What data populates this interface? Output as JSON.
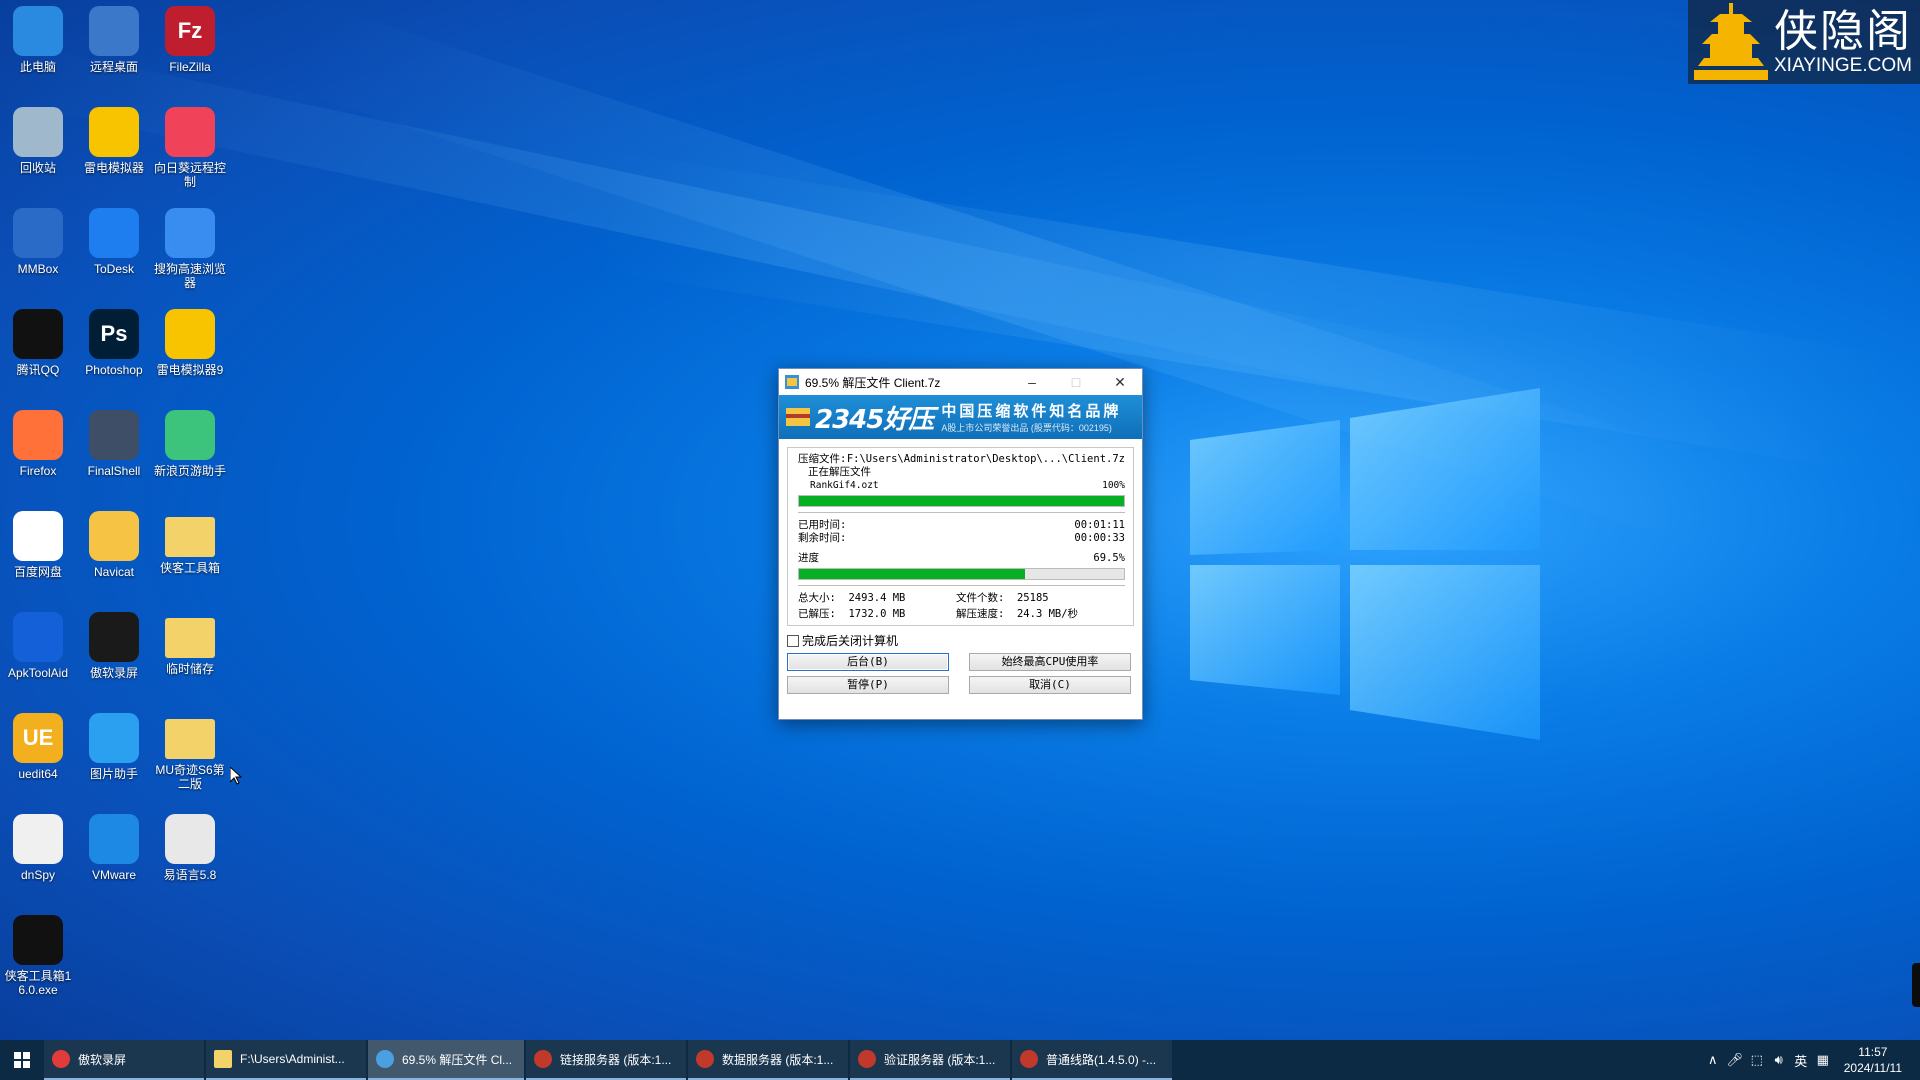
{
  "desktop_icons": [
    {
      "label": "此电脑",
      "icon": "computer-icon",
      "color": "#2a8ae0"
    },
    {
      "label": "远程桌面",
      "icon": "remote-desktop-icon",
      "color": "#3b78c9"
    },
    {
      "label": "FileZilla",
      "icon": "filezilla-icon",
      "color": "#bf1e2e",
      "glyph": "Fz"
    },
    {
      "label": "回收站",
      "icon": "recycle-bin-icon",
      "color": "#9fb8cc"
    },
    {
      "label": "雷电模拟器",
      "icon": "ldplayer-icon",
      "color": "#f8c400"
    },
    {
      "label": "向日葵远程控制",
      "icon": "sunlogin-icon",
      "color": "#f0435a"
    },
    {
      "label": "MMBox",
      "icon": "mmbox-icon",
      "color": "#2b6bc8"
    },
    {
      "label": "ToDesk",
      "icon": "todesk-icon",
      "color": "#1e7ef0"
    },
    {
      "label": "搜狗高速浏览器",
      "icon": "sogou-browser-icon",
      "color": "#3a8df0"
    },
    {
      "label": "腾讯QQ",
      "icon": "qq-icon",
      "color": "#111111"
    },
    {
      "label": "Photoshop",
      "icon": "photoshop-icon",
      "color": "#001e36",
      "glyph": "Ps"
    },
    {
      "label": "雷电模拟器9",
      "icon": "ldplayer9-icon",
      "color": "#f8c400"
    },
    {
      "label": "Firefox",
      "icon": "firefox-icon",
      "color": "#ff7139"
    },
    {
      "label": "FinalShell",
      "icon": "finalshell-icon",
      "color": "#3d4e66"
    },
    {
      "label": "新浪页游助手",
      "icon": "sina-game-icon",
      "color": "#3cc47c"
    },
    {
      "label": "百度网盘",
      "icon": "baidu-netdisk-icon",
      "color": "#ffffff"
    },
    {
      "label": "Navicat",
      "icon": "navicat-icon",
      "color": "#f6c345"
    },
    {
      "label": "侠客工具箱",
      "icon": "folder-icon",
      "color": "#f3d26a"
    },
    {
      "label": "ApkToolAid",
      "icon": "apktoolaid-icon",
      "color": "#1460d8"
    },
    {
      "label": "傲软录屏",
      "icon": "apowersoft-recorder-icon",
      "color": "#1a1a1a"
    },
    {
      "label": "临时储存",
      "icon": "folder-icon",
      "color": "#f3d26a"
    },
    {
      "label": "uedit64",
      "icon": "ultraedit-icon",
      "color": "#f2b01e",
      "glyph": "UE"
    },
    {
      "label": "图片助手",
      "icon": "image-helper-icon",
      "color": "#2ba0f0"
    },
    {
      "label": "MU奇迹S6第二版",
      "icon": "folder-icon",
      "color": "#f3d26a"
    },
    {
      "label": "dnSpy",
      "icon": "dnspy-icon",
      "color": "#f0f0f0"
    },
    {
      "label": "VMware",
      "icon": "vmware-icon",
      "color": "#1e88e5"
    },
    {
      "label": "易语言5.8",
      "icon": "eyuyan-icon",
      "color": "#e8e8e8"
    },
    {
      "label": "侠客工具箱16.0.exe",
      "icon": "xiake-toolbox-icon",
      "color": "#111111"
    }
  ],
  "watermark": {
    "cn": "侠隐阁",
    "en": "XIAYINGE.COM"
  },
  "dialog": {
    "title": "69.5% 解压文件 Client.7z",
    "brand": "2345好压",
    "slogan": "中国压缩软件知名品牌",
    "slogan_sub": "A股上市公司荣誉出品 (股票代码：002195)",
    "archive_label": "压缩文件:",
    "archive_path": "F:\\Users\\Administrator\\Desktop\\...\\Client.7z",
    "status": "正在解压文件",
    "current_file": "RankGif4.ozt",
    "current_percent": "100%",
    "current_progress": 1.0,
    "elapsed_label": "已用时间:",
    "elapsed": "00:01:11",
    "remaining_label": "剩余时间:",
    "remaining": "00:00:33",
    "progress_label": "进度",
    "progress_percent": "69.5%",
    "progress": 0.695,
    "total_size_label": "总大小:",
    "total_size": "2493.4 MB",
    "file_count_label": "文件个数:",
    "file_count": "25185",
    "extracted_label": "已解压:",
    "extracted": "1732.0 MB",
    "speed_label": "解压速度:",
    "speed": "24.3 MB/秒",
    "shutdown_checkbox": "完成后关闭计算机",
    "btn_background": "后台(B)",
    "btn_max_cpu": "始终最高CPU使用率",
    "btn_pause": "暂停(P)",
    "btn_cancel": "取消(C)"
  },
  "taskbar": {
    "items": [
      {
        "label": "傲软录屏",
        "icon": "apowersoft-recorder-icon",
        "color": "#e23b3b"
      },
      {
        "label": "F:\\Users\\Administ...",
        "icon": "folder-icon",
        "color": "#f3d26a"
      },
      {
        "label": "69.5% 解压文件 Cl...",
        "icon": "haozip-icon",
        "color": "#4aa0e0"
      },
      {
        "label": "链接服务器 (版本:1...",
        "icon": "mu-server-icon",
        "color": "#c0392b"
      },
      {
        "label": "数据服务器 (版本:1...",
        "icon": "mu-server-icon",
        "color": "#c0392b"
      },
      {
        "label": "验证服务器 (版本:1...",
        "icon": "mu-server-icon",
        "color": "#c0392b"
      },
      {
        "label": "普通线路(1.4.5.0) -...",
        "icon": "mu-server-icon",
        "color": "#c0392b"
      }
    ],
    "ime": "英",
    "time": "11:57",
    "date": "2024/11/11"
  }
}
